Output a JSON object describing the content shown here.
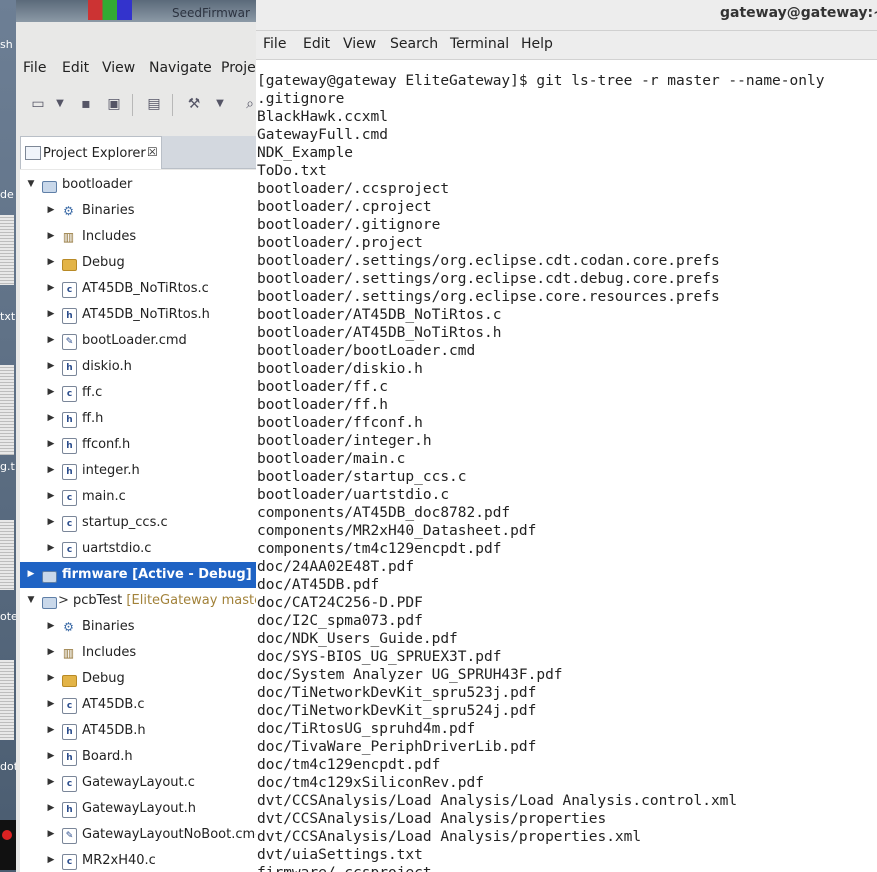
{
  "desktop": {
    "fragments": [
      "sh",
      "de",
      "txt",
      "g.t",
      "ote",
      "dot"
    ]
  },
  "eclipse": {
    "title_fragment": "SeedFirmwar",
    "menu": [
      "File",
      "Edit",
      "View",
      "Navigate",
      "Proje"
    ],
    "project_explorer_tab": "Project Explorer",
    "tab_close_glyph": "☒",
    "tree": [
      {
        "depth": 0,
        "expanded": true,
        "icon": "project",
        "label": "bootloader"
      },
      {
        "depth": 1,
        "expanded": false,
        "icon": "binaries",
        "label": "Binaries"
      },
      {
        "depth": 1,
        "expanded": false,
        "icon": "includes",
        "label": "Includes"
      },
      {
        "depth": 1,
        "expanded": false,
        "icon": "folder",
        "label": "Debug"
      },
      {
        "depth": 1,
        "expanded": false,
        "icon": "c-file",
        "label": "AT45DB_NoTiRtos.c"
      },
      {
        "depth": 1,
        "expanded": false,
        "icon": "h-file",
        "label": "AT45DB_NoTiRtos.h"
      },
      {
        "depth": 1,
        "expanded": false,
        "icon": "cmd-file",
        "label": "bootLoader.cmd"
      },
      {
        "depth": 1,
        "expanded": false,
        "icon": "h-file",
        "label": "diskio.h"
      },
      {
        "depth": 1,
        "expanded": false,
        "icon": "c-file",
        "label": "ff.c"
      },
      {
        "depth": 1,
        "expanded": false,
        "icon": "h-file",
        "label": "ff.h"
      },
      {
        "depth": 1,
        "expanded": false,
        "icon": "h-file",
        "label": "ffconf.h"
      },
      {
        "depth": 1,
        "expanded": false,
        "icon": "h-file",
        "label": "integer.h"
      },
      {
        "depth": 1,
        "expanded": false,
        "icon": "c-file",
        "label": "main.c"
      },
      {
        "depth": 1,
        "expanded": false,
        "icon": "c-file",
        "label": "startup_ccs.c"
      },
      {
        "depth": 1,
        "expanded": false,
        "icon": "c-file",
        "label": "uartstdio.c"
      },
      {
        "depth": 0,
        "expanded": false,
        "icon": "project",
        "label": "firmware",
        "decoration": "[Active - Debug]",
        "selected": true
      },
      {
        "depth": 0,
        "expanded": true,
        "icon": "project-git",
        "prefix": "> ",
        "label": "pcbTest",
        "decoration": "[EliteGateway maste"
      },
      {
        "depth": 1,
        "expanded": false,
        "icon": "binaries",
        "label": "Binaries"
      },
      {
        "depth": 1,
        "expanded": false,
        "icon": "includes",
        "label": "Includes"
      },
      {
        "depth": 1,
        "expanded": false,
        "icon": "folder",
        "label": "Debug"
      },
      {
        "depth": 1,
        "expanded": false,
        "icon": "c-file",
        "label": "AT45DB.c"
      },
      {
        "depth": 1,
        "expanded": false,
        "icon": "h-file",
        "label": "AT45DB.h"
      },
      {
        "depth": 1,
        "expanded": false,
        "icon": "h-file",
        "label": "Board.h"
      },
      {
        "depth": 1,
        "expanded": false,
        "icon": "c-file",
        "label": "GatewayLayout.c"
      },
      {
        "depth": 1,
        "expanded": false,
        "icon": "h-file",
        "label": "GatewayLayout.h"
      },
      {
        "depth": 1,
        "expanded": false,
        "icon": "cmd-file",
        "label": "GatewayLayoutNoBoot.cmd"
      },
      {
        "depth": 1,
        "expanded": false,
        "icon": "c-file",
        "label": "MR2xH40.c"
      }
    ]
  },
  "terminal": {
    "title": "gateway@gateway:~/El",
    "menu": [
      "File",
      "Edit",
      "View",
      "Search",
      "Terminal",
      "Help"
    ],
    "lines": [
      "[gateway@gateway EliteGateway]$ git ls-tree -r master --name-only",
      ".gitignore",
      "BlackHawk.ccxml",
      "GatewayFull.cmd",
      "NDK_Example",
      "ToDo.txt",
      "bootloader/.ccsproject",
      "bootloader/.cproject",
      "bootloader/.gitignore",
      "bootloader/.project",
      "bootloader/.settings/org.eclipse.cdt.codan.core.prefs",
      "bootloader/.settings/org.eclipse.cdt.debug.core.prefs",
      "bootloader/.settings/org.eclipse.core.resources.prefs",
      "bootloader/AT45DB_NoTiRtos.c",
      "bootloader/AT45DB_NoTiRtos.h",
      "bootloader/bootLoader.cmd",
      "bootloader/diskio.h",
      "bootloader/ff.c",
      "bootloader/ff.h",
      "bootloader/ffconf.h",
      "bootloader/integer.h",
      "bootloader/main.c",
      "bootloader/startup_ccs.c",
      "bootloader/uartstdio.c",
      "components/AT45DB_doc8782.pdf",
      "components/MR2xH40_Datasheet.pdf",
      "components/tm4c129encpdt.pdf",
      "doc/24AA02E48T.pdf",
      "doc/AT45DB.pdf",
      "doc/CAT24C256-D.PDF",
      "doc/I2C_spma073.pdf",
      "doc/NDK_Users_Guide.pdf",
      "doc/SYS-BIOS_UG_SPRUEX3T.pdf",
      "doc/System Analyzer UG_SPRUH43F.pdf",
      "doc/TiNetworkDevKit_spru523j.pdf",
      "doc/TiNetworkDevKit_spru524j.pdf",
      "doc/TiRtosUG_spruhd4m.pdf",
      "doc/TivaWare_PeriphDriverLib.pdf",
      "doc/tm4c129encpdt.pdf",
      "doc/tm4c129xSiliconRev.pdf",
      "dvt/CCSAnalysis/Load Analysis/Load Analysis.control.xml",
      "dvt/CCSAnalysis/Load Analysis/properties",
      "dvt/CCSAnalysis/Load Analysis/properties.xml",
      "dvt/uiaSettings.txt",
      "firmware/.ccsproject"
    ]
  }
}
